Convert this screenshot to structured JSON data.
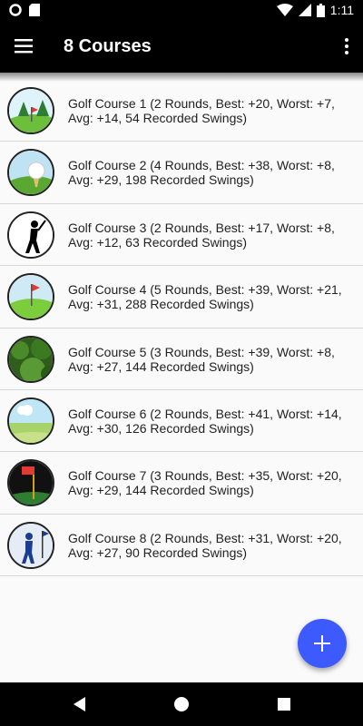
{
  "status": {
    "time": "1:11"
  },
  "header": {
    "title": "8 Courses"
  },
  "courses": [
    {
      "label": "Golf Course 1 (2 Rounds, Best: +20, Worst: +7, Avg: +14, 54 Recorded Swings)",
      "icon": "trees-flag-icon"
    },
    {
      "label": "Golf Course 2 (4 Rounds, Best: +38, Worst: +8, Avg: +29, 198 Recorded Swings)",
      "icon": "golf-ball-tee-icon"
    },
    {
      "label": "Golf Course 3 (2 Rounds, Best: +17, Worst: +8, Avg: +12, 63 Recorded Swings)",
      "icon": "golfer-silhouette-icon"
    },
    {
      "label": "Golf Course 4 (5 Rounds, Best: +39, Worst: +21, Avg: +31, 288 Recorded Swings)",
      "icon": "green-flag-icon"
    },
    {
      "label": "Golf Course 5 (3 Rounds, Best: +39, Worst: +8, Avg: +27, 144 Recorded Swings)",
      "icon": "forest-icon"
    },
    {
      "label": "Golf Course 6 (2 Rounds, Best: +41, Worst: +14, Avg: +30, 126 Recorded Swings)",
      "icon": "fairway-icon"
    },
    {
      "label": "Golf Course 7 (3 Rounds, Best: +35, Worst: +20, Avg: +29, 144 Recorded Swings)",
      "icon": "nineteenth-hole-flag-icon"
    },
    {
      "label": "Golf Course 8 (2 Rounds, Best: +31, Worst: +20, Avg: +27, 90 Recorded Swings)",
      "icon": "golfer-blue-icon"
    }
  ],
  "fab": {
    "icon": "plus-icon"
  },
  "colors": {
    "accent": "#3d5afe",
    "appbar": "#000000"
  }
}
